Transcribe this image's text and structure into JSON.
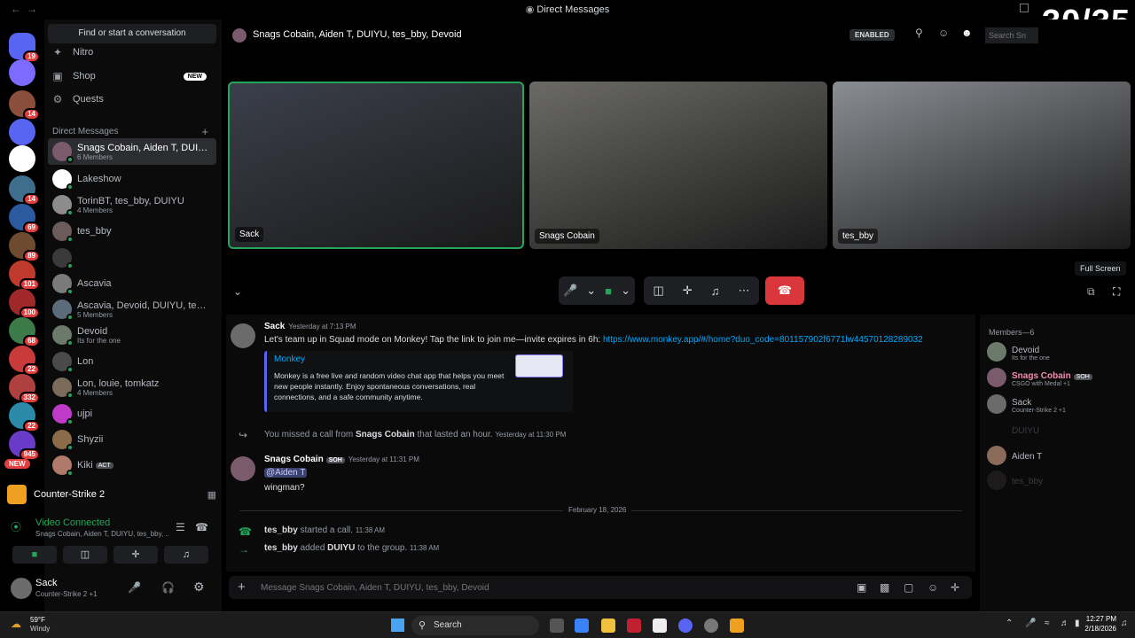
{
  "window": {
    "title": "Direct Messages",
    "counter": "30/35"
  },
  "servers": [
    {
      "badge": "19",
      "color": "#5865f2"
    },
    {
      "badge": "",
      "color": "#7b6cff"
    },
    {
      "badge": "14",
      "color": "#8a4f3a"
    },
    {
      "badge": "",
      "color": "#5865f2"
    },
    {
      "badge": "",
      "color": "#ffffff"
    },
    {
      "badge": "14",
      "color": "#3f6e8c"
    },
    {
      "badge": "69",
      "color": "#2b5a9e"
    },
    {
      "badge": "89",
      "color": "#6e4a2f"
    },
    {
      "badge": "101",
      "color": "#c03a2b"
    },
    {
      "badge": "100",
      "color": "#a02828"
    },
    {
      "badge": "68",
      "color": "#3c7a4a"
    },
    {
      "badge": "22",
      "color": "#c93a3a"
    },
    {
      "badge": "332",
      "color": "#b04040"
    },
    {
      "badge": "22",
      "color": "#2a8aa8"
    },
    {
      "badge": "945",
      "color": "#6a3ac9"
    }
  ],
  "servers_new": "NEW",
  "sidebar": {
    "search": "Find or start a conversation",
    "nitro": "Nitro",
    "shop": "Shop",
    "shop_badge": "NEW",
    "quests": "Quests",
    "dm_header": "Direct Messages",
    "dms": [
      {
        "name": "Snags Cobain, Aiden T, DUIYU, ...",
        "sub": "6 Members",
        "color": "#7a5b6b",
        "selected": true
      },
      {
        "name": "Lakeshow",
        "sub": "",
        "color": "#ffffff"
      },
      {
        "name": "TorinBT, tes_bby, DUIYU",
        "sub": "4 Members",
        "color": "#8c8c8c"
      },
      {
        "name": "tes_bby",
        "sub": "",
        "color": "#6b5b5b"
      },
      {
        "name": "",
        "sub": "",
        "color": "#3a3a3a"
      },
      {
        "name": "Ascavia",
        "sub": "",
        "color": "#7a7a7a"
      },
      {
        "name": "Ascavia, Devoid, DUIYU, tes_b...",
        "sub": "5 Members",
        "color": "#5b6b7a"
      },
      {
        "name": "Devoid",
        "sub": "Its for the one",
        "color": "#6b7a6b"
      },
      {
        "name": "Lon",
        "sub": "",
        "color": "#4a4a4a"
      },
      {
        "name": "Lon, louie, tomkatz",
        "sub": "4 Members",
        "color": "#7a6b5b"
      },
      {
        "name": "ujpi",
        "sub": "",
        "color": "#c03ac9"
      },
      {
        "name": "Shyzii",
        "sub": "",
        "color": "#8a6b4a"
      },
      {
        "name": "Kiki",
        "sub": "",
        "color": "#b07a6b",
        "tag": "ACT"
      }
    ]
  },
  "activity": {
    "game": "Counter-Strike 2",
    "voice_status": "Video Connected",
    "voice_channel": "Snags Cobain, Aiden T, DUIYU, tes_bby, ..."
  },
  "user": {
    "name": "Sack",
    "status": "Counter-Strike 2 +1"
  },
  "header": {
    "title": "Snags Cobain, Aiden T, DUIYU, tes_bby, Devoid",
    "enabled": "ENABLED",
    "search_placeholder": "Search Sn"
  },
  "tiles": [
    {
      "label": "Sack",
      "color": "#3b3f4a"
    },
    {
      "label": "Snags Cobain",
      "color": "#6b6a66"
    },
    {
      "label": "tes_bby",
      "color": "#8a8d93"
    }
  ],
  "tooltip": "Full Screen",
  "messages": {
    "m1": {
      "author": "Sack",
      "time": "Yesterday at 7:13 PM",
      "text": "Let's team up in Squad mode on Monkey! Tap the link to join me—invite expires in 6h: ",
      "link": "https://www.monkey.app/#/home?duo_code=801157902f6771lw44570128289032"
    },
    "embed": {
      "title": "Monkey",
      "desc": "Monkey is a free live and random video chat app that helps you meet new people instantly. Enjoy spontaneous conversations, real connections, and a safe community anytime."
    },
    "missed": {
      "pre": "You missed a call from ",
      "who": "Snags Cobain",
      "post": " that lasted an hour.",
      "time": "Yesterday at 11:30 PM"
    },
    "m2": {
      "author": "Snags Cobain",
      "tag": "SOH",
      "time": "Yesterday at 11:31 PM",
      "mention": "@Aiden T",
      "text": "wingman?"
    },
    "divider": "February 18, 2026",
    "call": {
      "who": "tes_bby",
      "text": " started a call.",
      "time": "11:38 AM"
    },
    "added": {
      "who": "tes_bby",
      "mid": " added ",
      "target": "DUIYU",
      "post": " to the group.",
      "time": "11:38 AM"
    }
  },
  "composer": {
    "placeholder": "Message Snags Cobain, Aiden T, DUIYU, tes_bby, Devoid"
  },
  "members": {
    "header": "Members—6",
    "list": [
      {
        "name": "Devoid",
        "sub": "Its for the one",
        "color": "#6b7a6b",
        "bright": false
      },
      {
        "name": "Snags Cobain",
        "sub": "CSGO with Medal +1",
        "color": "#7a5b6b",
        "bright": true,
        "tag": "SOH"
      },
      {
        "name": "Sack",
        "sub": "Counter-Strike 2 +1",
        "color": "#6b6b6b",
        "bright": false
      },
      {
        "name": "DUIYU",
        "sub": "",
        "color": "#0a0a0b",
        "dim": true
      },
      {
        "name": "Aiden T",
        "sub": "",
        "color": "#8a6b5b",
        "bright": false
      },
      {
        "name": "tes_bby",
        "sub": "",
        "color": "#3a3535",
        "dim": true
      }
    ]
  },
  "taskbar": {
    "temp": "59°F",
    "weather": "Windy",
    "search": "Search",
    "time": "12:27 PM",
    "date": "2/18/2026"
  }
}
